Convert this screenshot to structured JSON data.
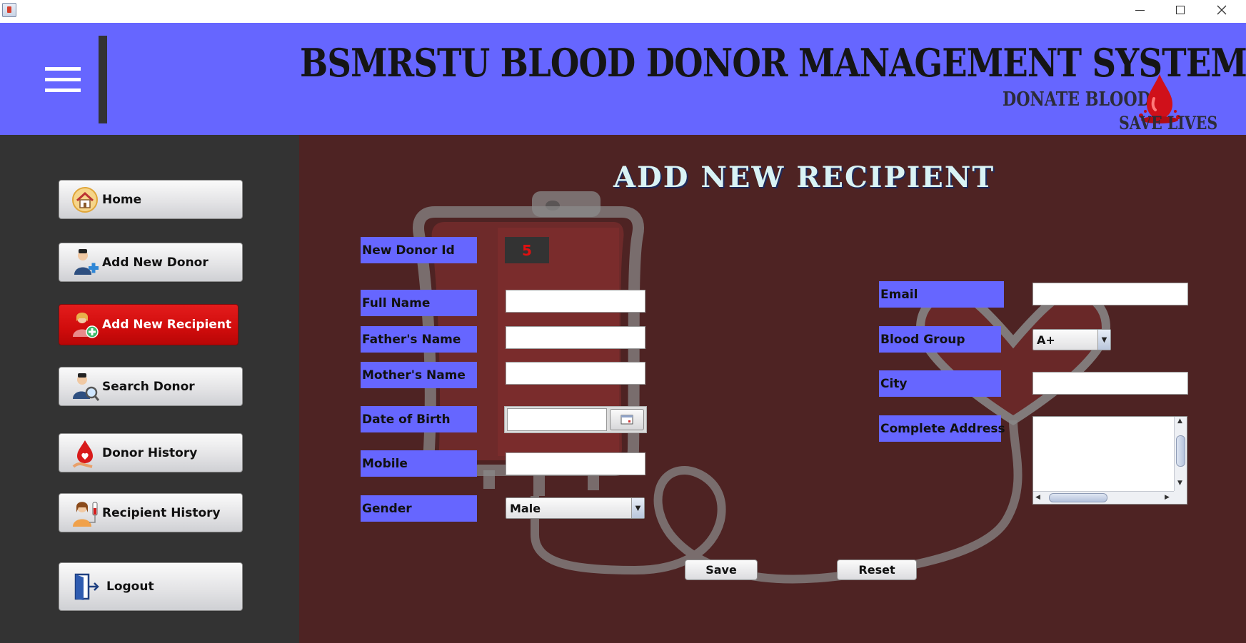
{
  "window": {
    "title": ""
  },
  "header": {
    "app_title": "BSMRSTU BLOOD DONOR MANAGEMENT SYSTEM",
    "tagline_top": "DONATE BLOOD",
    "tagline_bottom": "SAVE LIVES",
    "menu_icon": "hamburger-icon",
    "logo_icon": "blood-drop-icon",
    "bg_color": "#6666ff"
  },
  "sidebar": {
    "bg_color": "#333333",
    "items": [
      {
        "label": "Home",
        "icon": "home-icon",
        "active": false
      },
      {
        "label": "Add New Donor",
        "icon": "add-donor-icon",
        "active": false
      },
      {
        "label": "Add New Recipient",
        "icon": "add-recipient-icon",
        "active": true
      },
      {
        "label": "Search Donor",
        "icon": "search-donor-icon",
        "active": false
      },
      {
        "label": "Donor History",
        "icon": "donor-history-icon",
        "active": false
      },
      {
        "label": "Recipient History",
        "icon": "recipient-history-icon",
        "active": false
      },
      {
        "label": "Logout",
        "icon": "logout-icon",
        "active": false
      }
    ]
  },
  "form": {
    "title": "ADD NEW RECIPIENT",
    "bg_color": "#4e2323",
    "label_color": "#6666ff",
    "fields": {
      "donor_id": {
        "label": "New Donor Id",
        "value": "5"
      },
      "full_name": {
        "label": "Full Name",
        "value": ""
      },
      "father_name": {
        "label": "Father's Name",
        "value": ""
      },
      "mother_name": {
        "label": "Mother's Name",
        "value": ""
      },
      "dob": {
        "label": "Date of Birth",
        "value": ""
      },
      "mobile": {
        "label": "Mobile",
        "value": ""
      },
      "gender": {
        "label": "Gender",
        "value": "Male"
      },
      "email": {
        "label": "Email",
        "value": ""
      },
      "blood_group": {
        "label": "Blood Group",
        "value": "A+"
      },
      "city": {
        "label": "City",
        "value": ""
      },
      "address": {
        "label": "Complete Address",
        "value": ""
      }
    },
    "save_label": "Save",
    "reset_label": "Reset"
  }
}
